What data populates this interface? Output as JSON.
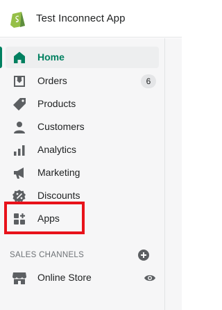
{
  "header": {
    "store_name": "Test Inconnect App"
  },
  "nav": {
    "items": [
      {
        "key": "home",
        "label": "Home",
        "icon": "home-icon",
        "active": true
      },
      {
        "key": "orders",
        "label": "Orders",
        "icon": "orders-icon",
        "badge": "6"
      },
      {
        "key": "products",
        "label": "Products",
        "icon": "products-tag-icon"
      },
      {
        "key": "customers",
        "label": "Customers",
        "icon": "customers-icon"
      },
      {
        "key": "analytics",
        "label": "Analytics",
        "icon": "analytics-icon"
      },
      {
        "key": "marketing",
        "label": "Marketing",
        "icon": "marketing-megaphone-icon"
      },
      {
        "key": "discounts",
        "label": "Discounts",
        "icon": "discounts-icon"
      },
      {
        "key": "apps",
        "label": "Apps",
        "icon": "apps-icon",
        "highlighted": true
      }
    ]
  },
  "sales_channels": {
    "title": "SALES CHANNELS",
    "items": [
      {
        "key": "online_store",
        "label": "Online Store",
        "icon": "online-store-icon"
      }
    ]
  },
  "colors": {
    "accent": "#008060",
    "icon": "#5c5f62",
    "highlight": "#e8121a",
    "sidebar_bg": "#f6f6f7"
  }
}
